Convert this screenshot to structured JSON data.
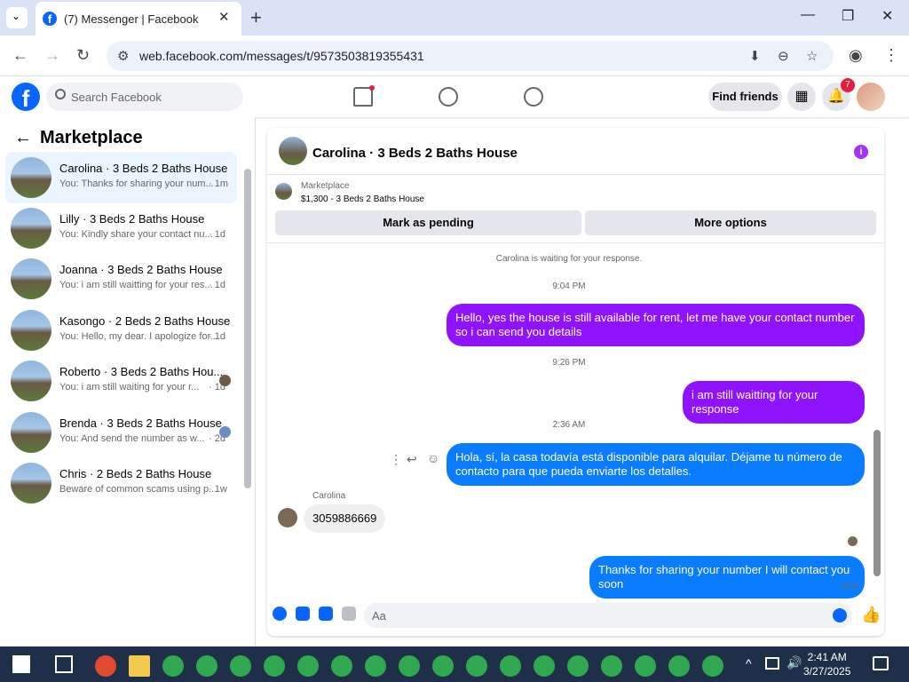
{
  "browser": {
    "tab_title": "(7) Messenger | Facebook",
    "new_tab": "+",
    "url": "web.facebook.com/messages/t/9573503819355431",
    "win_min": "—",
    "win_max": "❐",
    "win_close": "✕"
  },
  "facebook": {
    "logo": "f",
    "search_placeholder": "Search Facebook",
    "find_friends": "Find friends",
    "notification_count": "7"
  },
  "sidebar": {
    "title": "Marketplace",
    "conversations": [
      {
        "name": "Carolina · 3 Beds 2 Baths House",
        "preview": "You: Thanks for sharing your num...",
        "time": "· 1m"
      },
      {
        "name": "Lilly · 3 Beds 2 Baths House",
        "preview": "You: Kindly share your contact nu...",
        "time": "· 1d"
      },
      {
        "name": "Joanna · 3 Beds 2 Baths House",
        "preview": "You: i am still waitting for your res...",
        "time": "· 1d"
      },
      {
        "name": "Kasongo · 2 Beds 2 Baths House",
        "preview": "You: Hello, my dear. I apologize for...",
        "time": "· 1d"
      },
      {
        "name": "Roberto · 3 Beds 2 Baths Hou...",
        "preview": "You: i am still waiting for your r...",
        "time": "· 1d"
      },
      {
        "name": "Brenda · 3 Beds 2 Baths House",
        "preview": "You: And send the number as w...",
        "time": "· 2d"
      },
      {
        "name": "Chris · 2 Beds 2 Baths House",
        "preview": "Beware of common scams using p...",
        "time": "· 1w"
      }
    ]
  },
  "chat": {
    "title": "Carolina · 3 Beds 2 Baths House",
    "marketplace_label": "Marketplace",
    "listing": "$1,300 - 3 Beds 2 Baths House",
    "mark_pending": "Mark as pending",
    "more_options": "More options",
    "waiting_notice": "Carolina is waiting for your response.",
    "time1": "9:04 PM",
    "msg1": "Hello, yes the house is still available for rent, let me have your contact number so i can send you  details",
    "time2": "9:26 PM",
    "msg2": "i am still waitting for your response",
    "time3": "2:36 AM",
    "msg3": "Hola, sí, la casa todavía está disponible para alquilar. Déjame tu número de contacto para que pueda enviarte los detalles.",
    "sender": "Carolina",
    "msg4": "3059886669",
    "msg5": "Thanks for sharing your number I will contact you soon",
    "status": "Sent",
    "compose_placeholder": "Aa"
  },
  "taskbar": {
    "time": "2:41 AM",
    "date": "3/27/2025"
  }
}
